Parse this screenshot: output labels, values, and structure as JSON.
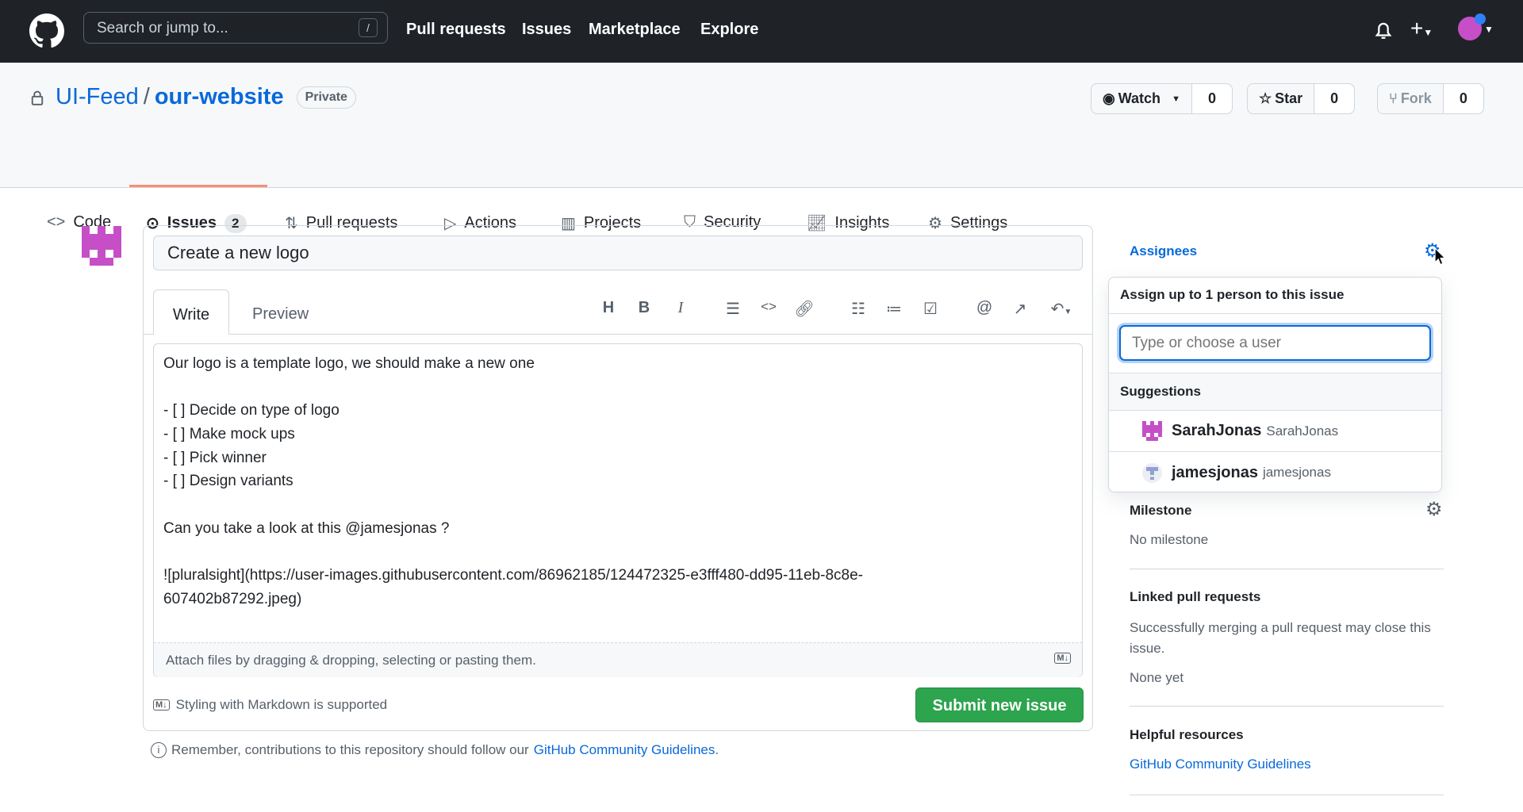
{
  "header": {
    "search_placeholder": "Search or jump to...",
    "search_shortcut": "/",
    "nav": [
      "Pull requests",
      "Issues",
      "Marketplace",
      "Explore"
    ]
  },
  "repo": {
    "owner": "UI-Feed",
    "separator": "/",
    "name": "our-website",
    "visibility": "Private",
    "watch": {
      "label": "Watch",
      "count": "0"
    },
    "star": {
      "label": "Star",
      "count": "0"
    },
    "fork": {
      "label": "Fork",
      "count": "0"
    }
  },
  "tabs": [
    {
      "label": "Code"
    },
    {
      "label": "Issues",
      "count": "2",
      "active": true
    },
    {
      "label": "Pull requests"
    },
    {
      "label": "Actions"
    },
    {
      "label": "Projects"
    },
    {
      "label": "Security"
    },
    {
      "label": "Insights"
    },
    {
      "label": "Settings"
    }
  ],
  "issue": {
    "title": "Create a new logo",
    "editor_tabs": [
      "Write",
      "Preview"
    ],
    "body_lines": [
      "Our logo is a template logo, we should make a new one",
      "",
      "- [ ] Decide on type of logo",
      "- [ ] Make mock ups",
      "- [ ] Pick winner",
      "- [ ] Design variants",
      "",
      "Can you take a look at this @jamesjonas ?",
      "",
      "![pluralsight](https://user-images.githubusercontent.com/86962185/124472325-e3fff480-dd95-11eb-8c8e-",
      "607402b87292.jpeg)"
    ],
    "attach_hint": "Attach files by dragging & dropping, selecting or pasting them.",
    "markdown_note": "Styling with Markdown is supported",
    "submit_label": "Submit new issue",
    "reminder_prefix": "Remember, contributions to this repository should follow our",
    "reminder_link": "GitHub Community Guidelines",
    "reminder_suffix": "."
  },
  "sidebar": {
    "assignees_label": "Assignees",
    "dropdown": {
      "title": "Assign up to 1 person to this issue",
      "filter_placeholder": "Type or choose a user",
      "section": "Suggestions",
      "users": [
        {
          "login": "SarahJonas",
          "name": "SarahJonas",
          "color": "#c64fc8"
        },
        {
          "login": "jamesjonas",
          "name": "jamesjonas",
          "color": "#8fa0d8"
        }
      ]
    },
    "milestone_label": "Milestone",
    "milestone_value": "No milestone",
    "linked_label": "Linked pull requests",
    "linked_text": "Successfully merging a pull request may close this issue.",
    "linked_value": "None yet",
    "resources_label": "Helpful resources",
    "resources_link": "GitHub Community Guidelines"
  },
  "colors": {
    "header_bg": "#1f2328",
    "link": "#0969da",
    "submit": "#2da44e",
    "tab_underline": "#fd8c73",
    "avatar": "#c64fc8"
  }
}
